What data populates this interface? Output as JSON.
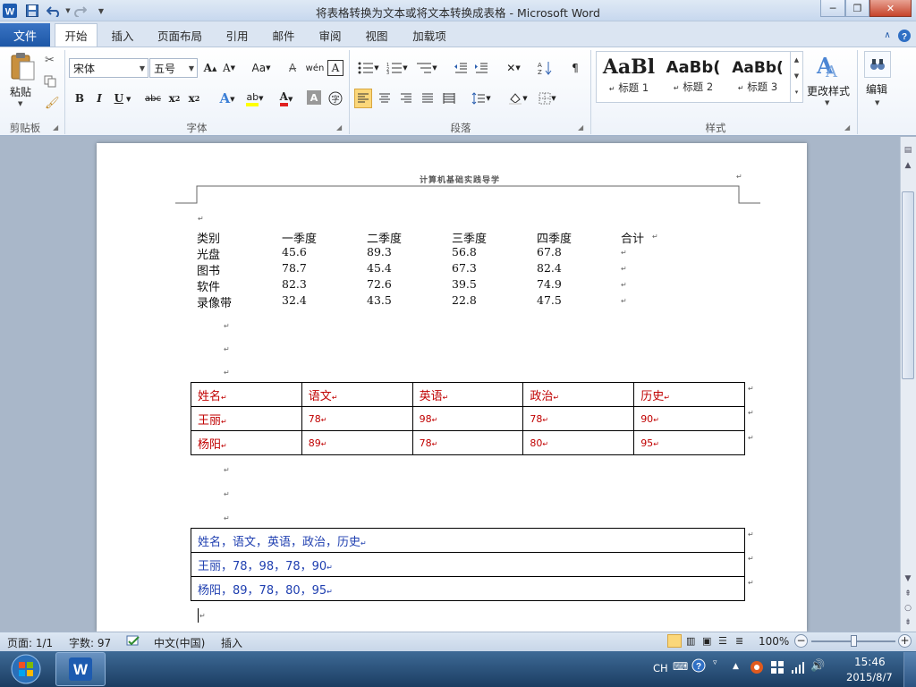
{
  "window": {
    "title": "将表格转换为文本或将文本转换成表格  -  Microsoft Word",
    "minimize": "─",
    "restore": "❐",
    "close": "✕"
  },
  "ribbon": {
    "tabs": [
      "文件",
      "开始",
      "插入",
      "页面布局",
      "引用",
      "邮件",
      "审阅",
      "视图",
      "加载项"
    ],
    "clipboard": {
      "paste": "粘贴",
      "label": "剪贴板"
    },
    "font": {
      "name": "宋体",
      "size": "五号",
      "label": "字体"
    },
    "paragraph": {
      "label": "段落"
    },
    "styles": {
      "label": "样式",
      "items": [
        {
          "preview": "AaBl",
          "name": "标题 1"
        },
        {
          "preview": "AaBb(",
          "name": "标题 2"
        },
        {
          "preview": "AaBb(",
          "name": "标题 3"
        }
      ],
      "change": "更改样式"
    },
    "editing": {
      "label": "编辑"
    }
  },
  "document": {
    "header_text": "计算机基础实践导学",
    "text_table": {
      "headers": [
        "类别",
        "一季度",
        "二季度",
        "三季度",
        "四季度",
        "合计"
      ],
      "rows": [
        [
          "光盘",
          "45.6",
          "89.3",
          "56.8",
          "67.8"
        ],
        [
          "图书",
          "78.7",
          "45.4",
          "67.3",
          "82.4"
        ],
        [
          "软件",
          "82.3",
          "72.6",
          "39.5",
          "74.9"
        ],
        [
          "录像带",
          "32.4",
          "43.5",
          "22.8",
          "47.5"
        ]
      ]
    },
    "grid_table": {
      "rows": [
        [
          "姓名",
          "语文",
          "英语",
          "政治",
          "历史"
        ],
        [
          "王丽",
          "78",
          "98",
          "78",
          "90"
        ],
        [
          "杨阳",
          "89",
          "78",
          "80",
          "95"
        ]
      ]
    },
    "comma_table": {
      "rows": [
        "姓名，语文，英语，政治，历史",
        "王丽，78，98，78，90",
        "杨阳，89，78，80，95"
      ]
    },
    "para_mark": "↵"
  },
  "status": {
    "page": "页面: 1/1",
    "words": "字数: 97",
    "language": "中文(中国)",
    "mode": "插入",
    "zoom": "100%",
    "zoom_minus": "−",
    "zoom_plus": "+"
  },
  "taskbar": {
    "lang": "CH",
    "time": "15:46",
    "date": "2015/8/7"
  },
  "colors": {
    "red_text": "#c00000",
    "blue_text": "#1f3fb0",
    "file_tab": "#2a64b5"
  }
}
